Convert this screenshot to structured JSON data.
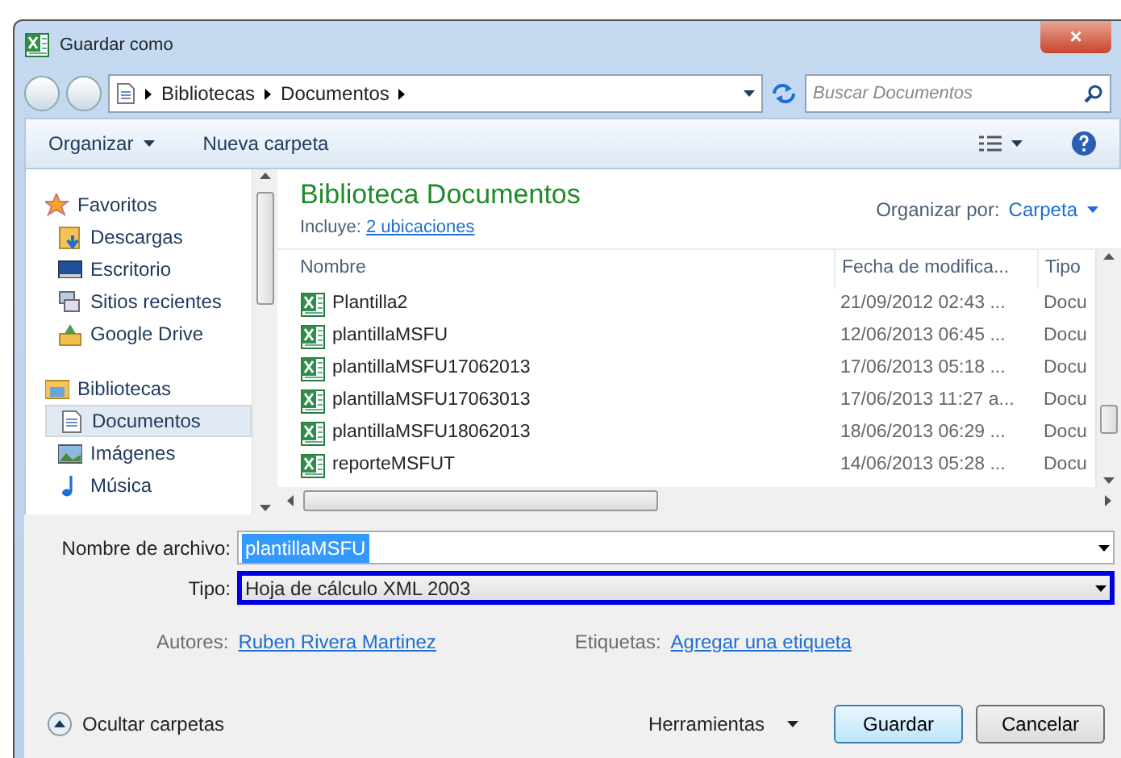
{
  "window": {
    "title": "Guardar como",
    "close": "×"
  },
  "address": {
    "path": [
      "Bibliotecas",
      "Documentos"
    ]
  },
  "search": {
    "placeholder": "Buscar Documentos"
  },
  "toolbar": {
    "items": [
      "Organizar",
      "Nueva carpeta"
    ]
  },
  "sidebar": {
    "groups": [
      {
        "label": "Favoritos",
        "kind": "star",
        "children": [
          {
            "label": "Descargas",
            "kind": "download",
            "selected": false
          },
          {
            "label": "Escritorio",
            "kind": "desktop",
            "selected": false
          },
          {
            "label": "Sitios recientes",
            "kind": "recent",
            "selected": false
          },
          {
            "label": "Google Drive",
            "kind": "drive",
            "selected": false
          }
        ]
      },
      {
        "label": "Bibliotecas",
        "kind": "library",
        "children": [
          {
            "label": "Documentos",
            "kind": "document",
            "selected": true
          },
          {
            "label": "Imágenes",
            "kind": "image",
            "selected": false
          },
          {
            "label": "Música",
            "kind": "music",
            "selected": false
          }
        ]
      }
    ]
  },
  "library": {
    "title": "Biblioteca Documentos",
    "includes_label": "Incluye:",
    "includes_link": "2 ubicaciones",
    "arrange_label": "Organizar por:",
    "arrange_value": "Carpeta"
  },
  "table": {
    "columns": [
      "Nombre",
      "Fecha de modifica...",
      "Tipo"
    ],
    "rows": [
      {
        "name": "Plantilla2",
        "date": "21/09/2012 02:43 ...",
        "type": "Docu"
      },
      {
        "name": "plantillaMSFU",
        "date": "12/06/2013 06:45 ...",
        "type": "Docu"
      },
      {
        "name": "plantillaMSFU17062013",
        "date": "17/06/2013 05:18 ...",
        "type": "Docu"
      },
      {
        "name": "plantillaMSFU17063013",
        "date": "17/06/2013 11:27 a...",
        "type": "Docu"
      },
      {
        "name": "plantillaMSFU18062013",
        "date": "18/06/2013 06:29 ...",
        "type": "Docu"
      },
      {
        "name": "reporteMSFUT",
        "date": "14/06/2013 05:28 ...",
        "type": "Docu"
      }
    ]
  },
  "form": {
    "filename_label": "Nombre de archivo:",
    "filename": "plantillaMSFU",
    "type_label": "Tipo:",
    "type": "Hoja de cálculo XML 2003",
    "type_focused": true,
    "authors_label": "Autores:",
    "authors": "Ruben Rivera Martinez",
    "tags_label": "Etiquetas:",
    "tags": "Agregar una etiqueta"
  },
  "footer": {
    "hide_folders": "Ocultar carpetas",
    "tools": "Herramientas",
    "buttons": [
      "Guardar",
      "Cancelar"
    ]
  }
}
